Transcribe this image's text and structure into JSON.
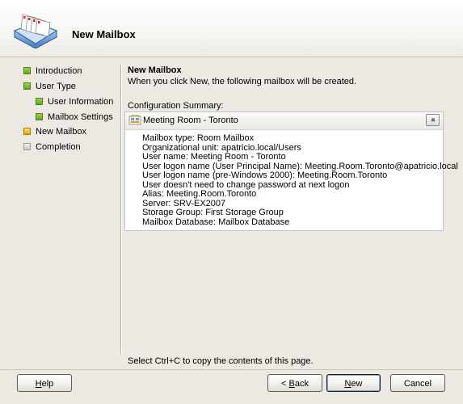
{
  "header": {
    "title": "New Mailbox",
    "icon": "mailbox-stack-icon"
  },
  "nav": {
    "items": [
      {
        "label": "Introduction",
        "status": "complete",
        "indent": 0
      },
      {
        "label": "User Type",
        "status": "complete",
        "indent": 0
      },
      {
        "label": "User Information",
        "status": "complete",
        "indent": 1
      },
      {
        "label": "Mailbox Settings",
        "status": "complete",
        "indent": 1
      },
      {
        "label": "New Mailbox",
        "status": "current",
        "indent": 0
      },
      {
        "label": "Completion",
        "status": "pending",
        "indent": 0
      }
    ]
  },
  "content": {
    "title": "New Mailbox",
    "description": "When you click New, the following mailbox will be created.",
    "config_label": "Configuration Summary:",
    "panel": {
      "title": "Meeting Room - Toronto",
      "collapse_glyph": "»",
      "lines": [
        "Mailbox type: Room Mailbox",
        "Organizational unit: apatricio.local/Users",
        "User name: Meeting Room - Toronto",
        "User logon name (User Principal Name): Meeting.Room.Toronto@apatricio.local",
        "User logon name (pre-Windows 2000): Meeting.Room.Toronto",
        "User doesn't need to change password at next logon",
        "Alias: Meeting.Room.Toronto",
        "Server: SRV-EX2007",
        "Storage Group: First Storage Group",
        "Mailbox Database: Mailbox Database"
      ]
    },
    "hint": "Select Ctrl+C to copy the contents of this page."
  },
  "buttons": {
    "help": {
      "accel": "H",
      "rest": "elp"
    },
    "back": {
      "prefix": "< ",
      "accel": "B",
      "rest": "ack"
    },
    "new": {
      "accel": "N",
      "rest": "ew"
    },
    "cancel": "Cancel"
  },
  "colors": {
    "complete": "#6fbf2a",
    "current": "#f0c000",
    "pending": "#c8c8c8"
  }
}
